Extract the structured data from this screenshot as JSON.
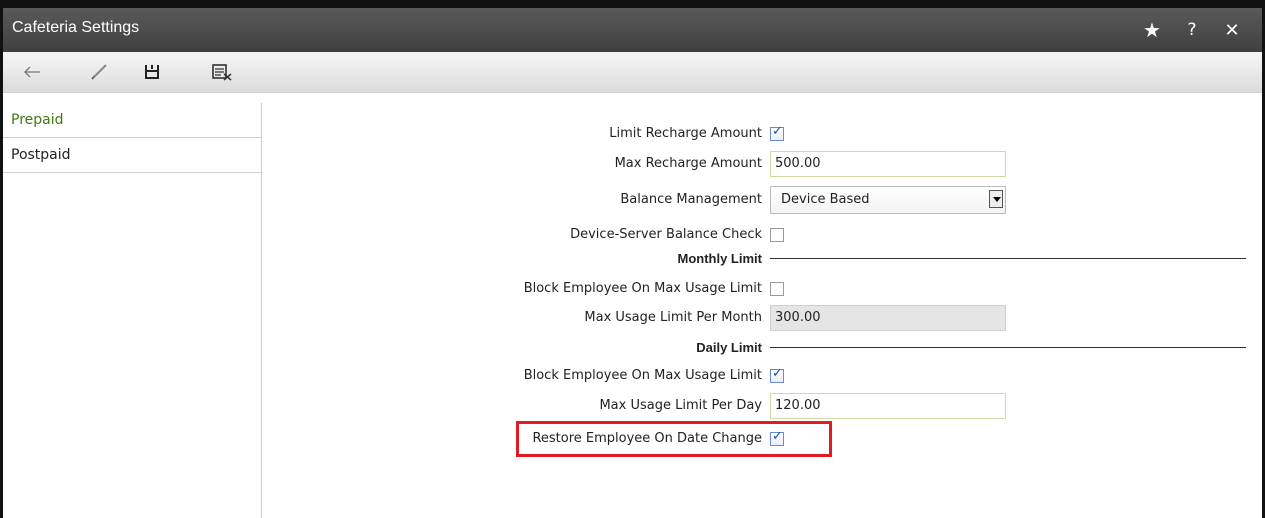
{
  "window": {
    "title": "Cafeteria Settings",
    "title_icons": [
      "star-icon",
      "help-icon",
      "close-icon"
    ]
  },
  "toolbar": {
    "icons": [
      "back-arrow-icon",
      "edit-pencil-icon",
      "save-icon",
      "clear-icon"
    ]
  },
  "sidebar": {
    "items": [
      {
        "label": "Prepaid",
        "active": true
      },
      {
        "label": "Postpaid",
        "active": false
      }
    ]
  },
  "form": {
    "limit_recharge": {
      "label": "Limit Recharge Amount",
      "checked": true
    },
    "max_recharge": {
      "label": "Max Recharge Amount",
      "value": "500.00"
    },
    "balance_mgmt": {
      "label": "Balance Management",
      "value": "Device Based"
    },
    "device_server_check": {
      "label": "Device-Server Balance Check",
      "checked": false
    },
    "monthly_section": "Monthly Limit",
    "monthly_block": {
      "label": "Block Employee On Max Usage Limit",
      "checked": false
    },
    "monthly_max": {
      "label": "Max Usage Limit Per Month",
      "value": "300.00"
    },
    "daily_section": "Daily Limit",
    "daily_block": {
      "label": "Block Employee On Max Usage Limit",
      "checked": true
    },
    "daily_max": {
      "label": "Max Usage Limit Per Day",
      "value": "120.00"
    },
    "restore_on_date": {
      "label": "Restore Employee On Date Change",
      "checked": true
    }
  },
  "colors": {
    "highlight": "#e01b24",
    "active_item": "#3f7a12"
  }
}
